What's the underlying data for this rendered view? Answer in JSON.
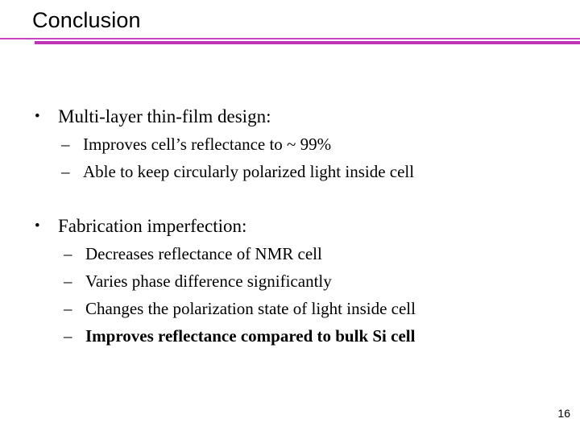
{
  "slide": {
    "title": "Conclusion",
    "page_number": "16",
    "accent_color_thin": "#cc44c0",
    "accent_color_thick": "#c032b8",
    "text_color": "#000000",
    "background_color": "#ffffff"
  },
  "body": {
    "groups": [
      {
        "bullet_marker": "•",
        "text": "Multi-layer thin-film design:",
        "bold": false,
        "sub_marker": "–",
        "sub_items": [
          {
            "text": "Improves cell’s reflectance to ~ 99%",
            "bold": false
          },
          {
            "text": "Able to keep circularly polarized light inside cell",
            "bold": false
          }
        ]
      },
      {
        "bullet_marker": "•",
        "text": "Fabrication imperfection:",
        "bold": false,
        "sub_marker": "–",
        "sub_items": [
          {
            "text": "Decreases reflectance of NMR cell",
            "bold": false
          },
          {
            "text": "Varies phase difference significantly",
            "bold": false
          },
          {
            "text": "Changes the polarization state of light inside cell",
            "bold": false
          },
          {
            "text": "Improves reflectance compared to bulk Si cell",
            "bold": true
          }
        ]
      }
    ]
  }
}
